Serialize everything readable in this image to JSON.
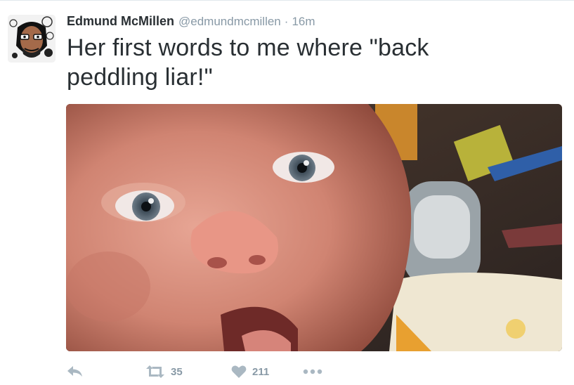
{
  "tweet": {
    "author_name": "Edmund McMillen",
    "handle": "@edmundmcmillen",
    "separator": "·",
    "time": "16m",
    "text": "Her first words to me where \"back peddling liar!\""
  },
  "actions": {
    "retweet_count": "35",
    "like_count": "211"
  },
  "icons": {
    "reply": "reply-icon",
    "retweet": "retweet-icon",
    "like": "heart-icon",
    "more": "more-dots-icon"
  },
  "colors": {
    "text": "#292f33",
    "muted": "#8899a6",
    "action_icon": "#aab8c2"
  }
}
